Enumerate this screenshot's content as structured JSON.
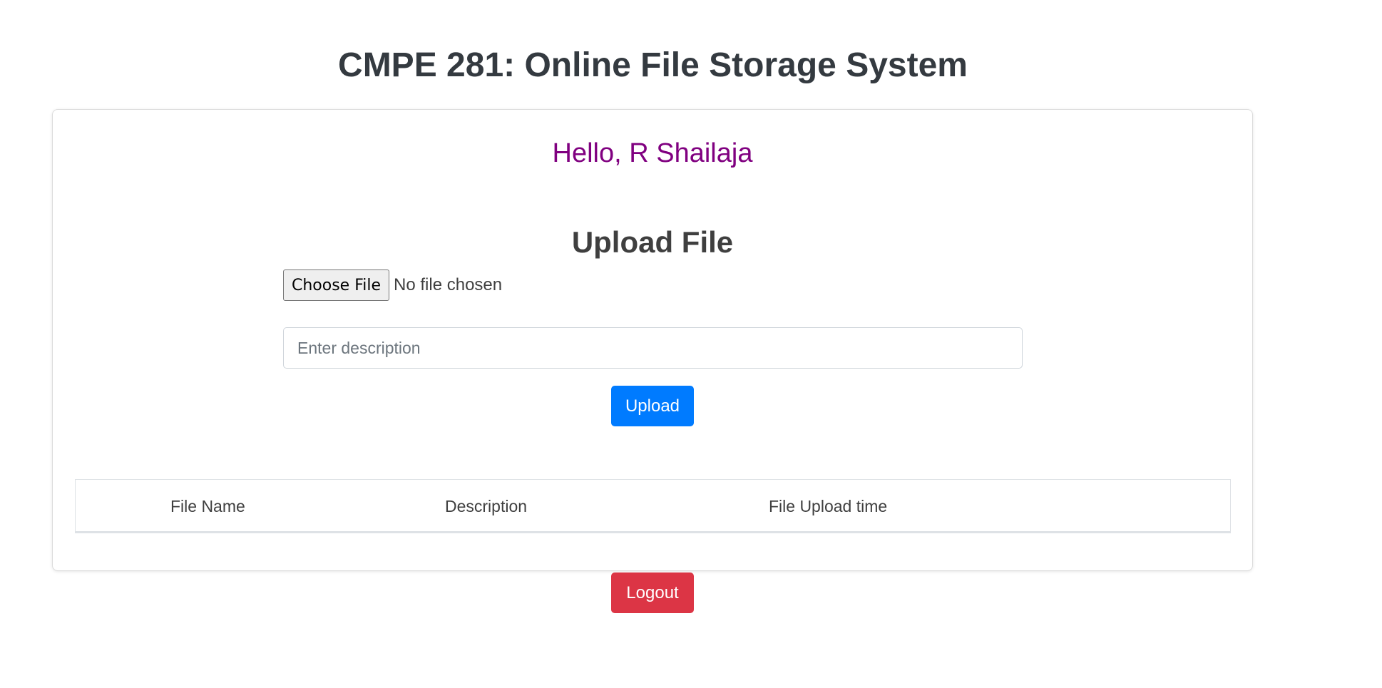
{
  "header": {
    "title": "CMPE 281: Online File Storage System"
  },
  "main": {
    "greeting": "Hello, R Shailaja",
    "upload": {
      "title": "Upload File",
      "choose_file_label": "Choose File",
      "file_status": "No file chosen",
      "description_placeholder": "Enter description",
      "description_value": "",
      "upload_label": "Upload"
    },
    "table": {
      "columns": [
        "File Name",
        "Description",
        "File Upload time"
      ],
      "rows": []
    }
  },
  "footer": {
    "logout_label": "Logout"
  },
  "colors": {
    "greeting": "#800080",
    "primary": "#007bff",
    "danger": "#dc3545"
  }
}
